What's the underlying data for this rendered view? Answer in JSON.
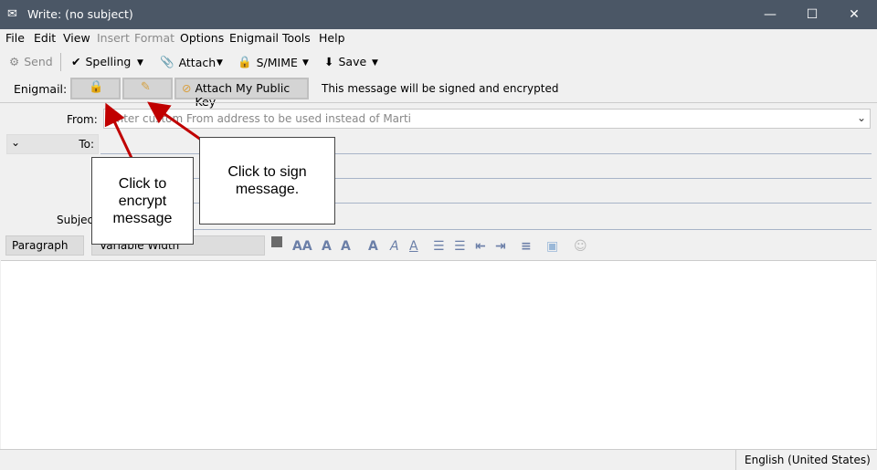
{
  "window": {
    "title": "Write: (no subject)",
    "minimize": "—",
    "maximize": "☐",
    "close": "✕"
  },
  "menu": [
    {
      "label": "File",
      "disabled": false
    },
    {
      "label": "Edit",
      "disabled": false
    },
    {
      "label": "View",
      "disabled": false
    },
    {
      "label": "Insert",
      "disabled": true
    },
    {
      "label": "Format",
      "disabled": true
    },
    {
      "label": "Options",
      "disabled": false
    },
    {
      "label": "Enigmail",
      "disabled": false
    },
    {
      "label": "Tools",
      "disabled": false
    },
    {
      "label": "Help",
      "disabled": false
    }
  ],
  "toolbar": {
    "send": "Send",
    "spelling": "Spelling",
    "attach": "Attach",
    "smime": "S/MIME",
    "save": "Save"
  },
  "enigmail": {
    "label": "Enigmail:",
    "attach_key": "Attach My Public Key",
    "status": "This message will be signed and encrypted"
  },
  "header": {
    "from_label": "From:",
    "from_placeholder": "Enter custom From address to be used instead of Marti",
    "to_label": "To:",
    "subject_label": "Subject"
  },
  "format": {
    "paragraph": "Paragraph",
    "font": "Variable Width"
  },
  "callouts": {
    "encrypt": "Click to encrypt message",
    "sign": "Click to sign message."
  },
  "status": {
    "language": "English (United States)"
  },
  "colors": {
    "titlebar": "#4b5766",
    "arrow": "#c00000"
  }
}
